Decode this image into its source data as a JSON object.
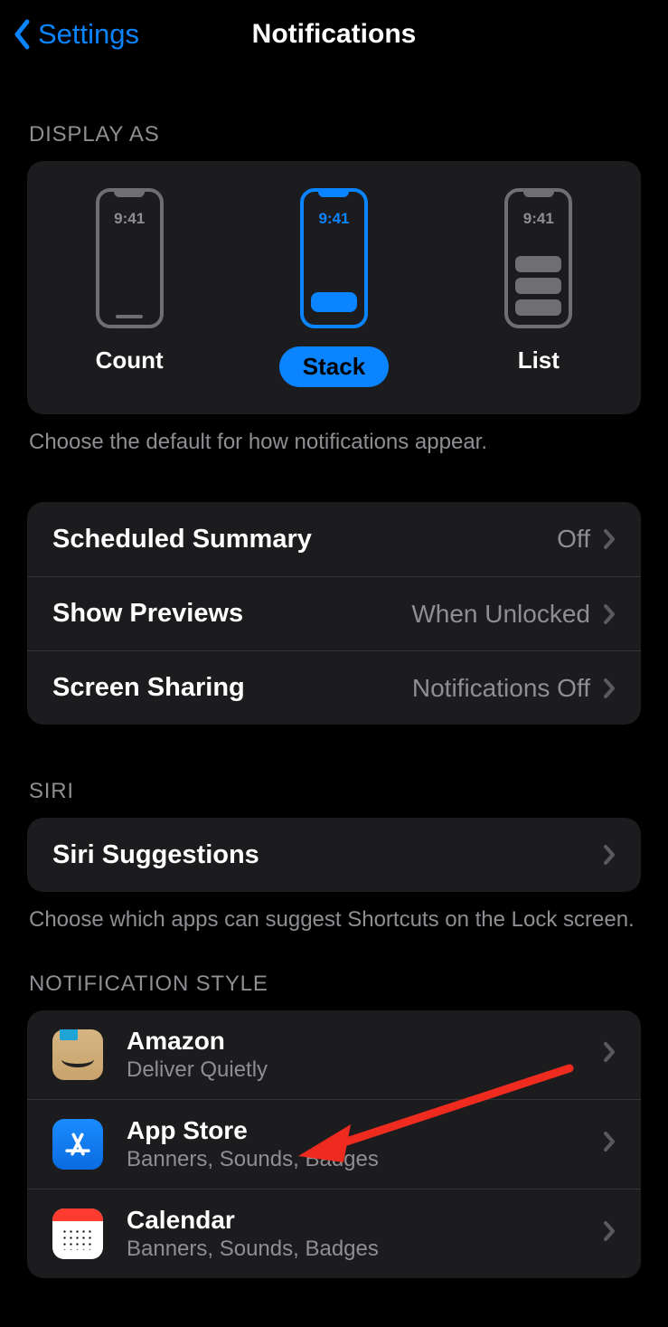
{
  "nav": {
    "back": "Settings",
    "title": "Notifications"
  },
  "displayAs": {
    "header": "DISPLAY AS",
    "time": "9:41",
    "options": [
      {
        "label": "Count",
        "selected": false
      },
      {
        "label": "Stack",
        "selected": true
      },
      {
        "label": "List",
        "selected": false
      }
    ],
    "footer": "Choose the default for how notifications appear."
  },
  "settings": [
    {
      "label": "Scheduled Summary",
      "value": "Off"
    },
    {
      "label": "Show Previews",
      "value": "When Unlocked"
    },
    {
      "label": "Screen Sharing",
      "value": "Notifications Off"
    }
  ],
  "siri": {
    "header": "SIRI",
    "row": "Siri Suggestions",
    "footer": "Choose which apps can suggest Shortcuts on the Lock screen."
  },
  "notifStyle": {
    "header": "NOTIFICATION STYLE",
    "apps": [
      {
        "name": "Amazon",
        "sub": "Deliver Quietly",
        "icon": "amazon"
      },
      {
        "name": "App Store",
        "sub": "Banners, Sounds, Badges",
        "icon": "appstore"
      },
      {
        "name": "Calendar",
        "sub": "Banners, Sounds, Badges",
        "icon": "calendar"
      }
    ]
  }
}
